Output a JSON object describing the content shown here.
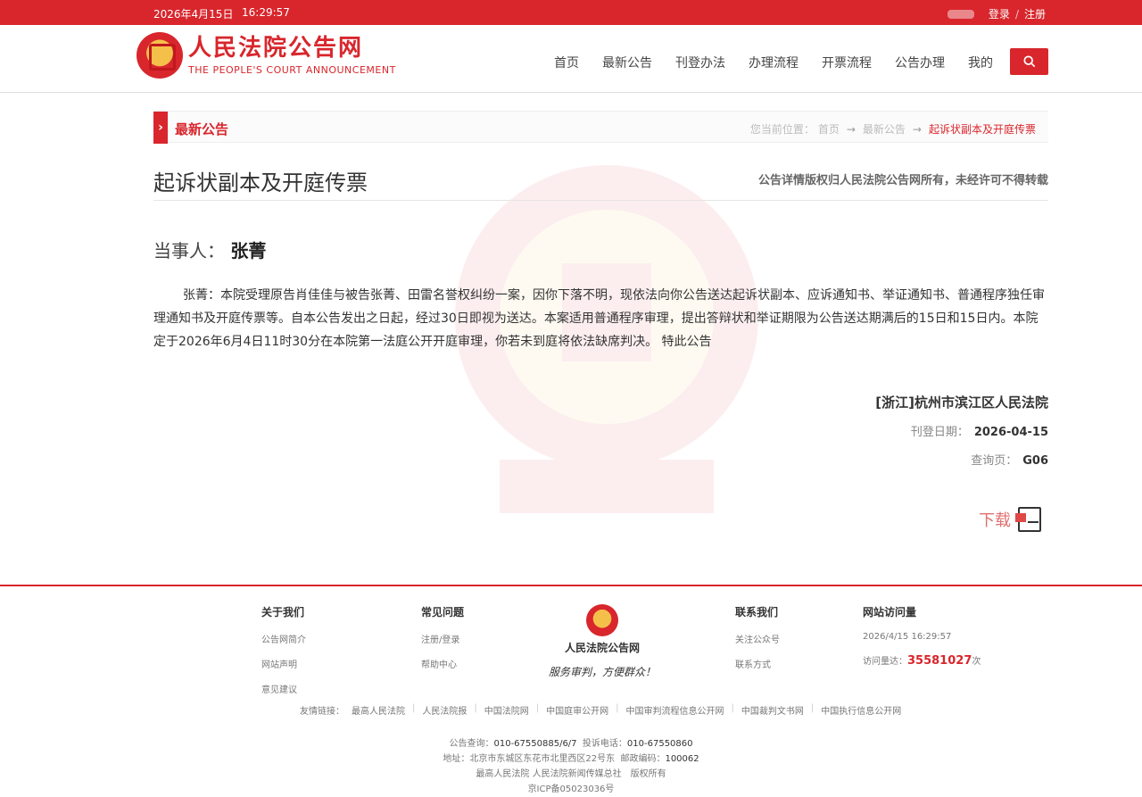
{
  "topbar": {
    "date": "2026年4月15日",
    "time": "16:29:57",
    "login": "登录",
    "separator": "/",
    "register": "注册"
  },
  "header": {
    "logo_cn": "人民法院公告网",
    "logo_en": "THE PEOPLE'S COURT ANNOUNCEMENT",
    "nav": [
      "首页",
      "最新公告",
      "刊登办法",
      "办理流程",
      "开票流程",
      "公告办理",
      "我的"
    ]
  },
  "breadcrumb": {
    "section": "最新公告",
    "prefix": "您当前位置：",
    "home": "首页",
    "parent": "最新公告",
    "current": "起诉状副本及开庭传票"
  },
  "notice": {
    "title": "起诉状副本及开庭传票",
    "copyright": "公告详情版权归人民法院公告网所有，未经许可不得转载",
    "party_label": "当事人：",
    "party_name": "张菁",
    "body": "张菁：本院受理原告肖佳佳与被告张菁、田雷名誉权纠纷一案，因你下落不明，现依法向你公告送达起诉状副本、应诉通知书、举证通知书、普通程序独任审理通知书及开庭传票等。自本公告发出之日起，经过30日即视为送达。本案适用普通程序审理，提出答辩状和举证期限为公告送达期满后的15日和15日内。本院定于2026年6月4日11时30分在本院第一法庭公开开庭审理，你若未到庭将依法缺席判决。 特此公告",
    "court": "[浙江]杭州市滨江区人民法院",
    "publish_label": "刊登日期：",
    "publish_date": "2026-04-15",
    "page_label": "查询页：",
    "page_value": "G06",
    "download": "下载"
  },
  "footer": {
    "about": {
      "title": "关于我们",
      "items": [
        "公告网简介",
        "网站声明",
        "意见建议"
      ]
    },
    "faq": {
      "title": "常见问题",
      "items": [
        "注册/登录",
        "帮助中心"
      ]
    },
    "logo_name": "人民法院公告网",
    "slogan": "服务审判，方便群众！",
    "contact": {
      "title": "联系我们",
      "items": [
        "关注公众号",
        "联系方式"
      ]
    },
    "visits": {
      "title": "网站访问量",
      "datetime": "2026/4/15 16:29:57",
      "label": "访问量达：",
      "count": "35581027",
      "unit": "次"
    },
    "links_label": "友情链接：",
    "links": [
      "最高人民法院",
      "人民法院报",
      "中国法院网",
      "中国庭审公开网",
      "中国审判流程信息公开网",
      "中国裁判文书网",
      "中国执行信息公开网"
    ],
    "query_phone_label": "公告查询：",
    "query_phone": "010-67550885/6/7",
    "complaint_label": "投诉电话：",
    "complaint_phone": "010-67550860",
    "address_label": "地址：",
    "address": "北京市东城区东花市北里西区22号东",
    "zip_label": "邮政编码：",
    "zip": "100062",
    "owner": "最高人民法院 人民法院新闻传媒总社　版权所有",
    "icp": "京ICP备05023036号"
  },
  "colors": {
    "brand_red": "#d8262c"
  }
}
